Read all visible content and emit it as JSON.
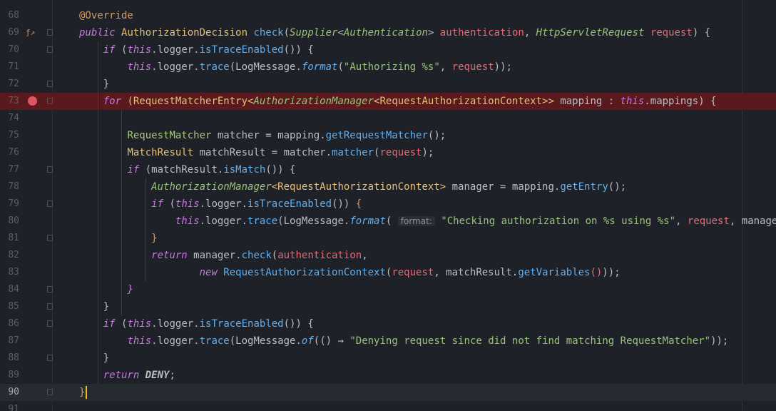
{
  "lines": [
    {
      "n": "68",
      "segs": [
        {
          "t": "@Override",
          "c": "ann"
        }
      ]
    },
    {
      "n": "69",
      "segs": [
        {
          "t": "public ",
          "c": "kw"
        },
        {
          "t": "AuthorizationDecision ",
          "c": "ty"
        },
        {
          "t": "check",
          "c": "fn"
        },
        {
          "t": "(",
          "c": "dim"
        },
        {
          "t": "Supplier",
          "c": "tyi"
        },
        {
          "t": "<",
          "c": "dim"
        },
        {
          "t": "Authentication",
          "c": "tyi"
        },
        {
          "t": "> ",
          "c": "dim"
        },
        {
          "t": "authentication",
          "c": "par"
        },
        {
          "t": ", ",
          "c": "dim"
        },
        {
          "t": "HttpServletRequest ",
          "c": "tyi"
        },
        {
          "t": "request",
          "c": "par"
        },
        {
          "t": ") {",
          "c": "dim"
        }
      ]
    },
    {
      "n": "70",
      "segs": [
        {
          "t": "    ",
          "c": "dim"
        },
        {
          "t": "if ",
          "c": "kw"
        },
        {
          "t": "(",
          "c": "dim"
        },
        {
          "t": "this",
          "c": "kw"
        },
        {
          "t": ".logger.",
          "c": "dim"
        },
        {
          "t": "isTraceEnabled",
          "c": "fn"
        },
        {
          "t": "()) {",
          "c": "dim"
        }
      ]
    },
    {
      "n": "71",
      "segs": [
        {
          "t": "        ",
          "c": "dim"
        },
        {
          "t": "this",
          "c": "kw"
        },
        {
          "t": ".logger.",
          "c": "dim"
        },
        {
          "t": "trace",
          "c": "fn"
        },
        {
          "t": "(LogMessage.",
          "c": "dim"
        },
        {
          "t": "format",
          "c": "fni"
        },
        {
          "t": "(",
          "c": "dim"
        },
        {
          "t": "\"Authorizing %s\"",
          "c": "str"
        },
        {
          "t": ", ",
          "c": "dim"
        },
        {
          "t": "request",
          "c": "par"
        },
        {
          "t": "));",
          "c": "dim"
        }
      ]
    },
    {
      "n": "72",
      "segs": [
        {
          "t": "    }",
          "c": "dim"
        }
      ]
    },
    {
      "n": "73",
      "bp": true,
      "segs": [
        {
          "t": "    ",
          "c": "dim"
        },
        {
          "t": "for ",
          "c": "kw"
        },
        {
          "t": "(RequestMatcherEntry<",
          "c": "ty"
        },
        {
          "t": "AuthorizationManager",
          "c": "tyi"
        },
        {
          "t": "<RequestAuthorizationContext>> ",
          "c": "ty"
        },
        {
          "t": "mapping : ",
          "c": "dim"
        },
        {
          "t": "this",
          "c": "kw"
        },
        {
          "t": ".mappings) {",
          "c": "dim"
        }
      ]
    },
    {
      "n": "74",
      "segs": []
    },
    {
      "n": "75",
      "segs": [
        {
          "t": "        ",
          "c": "dim"
        },
        {
          "t": "RequestMatcher ",
          "c": "tyg"
        },
        {
          "t": "matcher = mapping.",
          "c": "dim"
        },
        {
          "t": "getRequestMatcher",
          "c": "fn"
        },
        {
          "t": "();",
          "c": "dim"
        }
      ]
    },
    {
      "n": "76",
      "segs": [
        {
          "t": "        ",
          "c": "dim"
        },
        {
          "t": "MatchResult ",
          "c": "ty"
        },
        {
          "t": "matchResult = matcher.",
          "c": "dim"
        },
        {
          "t": "matcher",
          "c": "fn"
        },
        {
          "t": "(",
          "c": "dim"
        },
        {
          "t": "request",
          "c": "par"
        },
        {
          "t": ");",
          "c": "dim"
        }
      ]
    },
    {
      "n": "77",
      "segs": [
        {
          "t": "        ",
          "c": "dim"
        },
        {
          "t": "if ",
          "c": "kw"
        },
        {
          "t": "(matchResult.",
          "c": "dim"
        },
        {
          "t": "isMatch",
          "c": "fn"
        },
        {
          "t": "()) {",
          "c": "dim"
        }
      ]
    },
    {
      "n": "78",
      "segs": [
        {
          "t": "            ",
          "c": "dim"
        },
        {
          "t": "AuthorizationManager",
          "c": "tyi"
        },
        {
          "t": "<RequestAuthorizationContext> ",
          "c": "ty"
        },
        {
          "t": "manager = mapping.",
          "c": "dim"
        },
        {
          "t": "getEntry",
          "c": "fn"
        },
        {
          "t": "();",
          "c": "dim"
        }
      ]
    },
    {
      "n": "79",
      "segs": [
        {
          "t": "            ",
          "c": "dim"
        },
        {
          "t": "if ",
          "c": "kw"
        },
        {
          "t": "(",
          "c": "dim"
        },
        {
          "t": "this",
          "c": "kw"
        },
        {
          "t": ".logger.",
          "c": "dim"
        },
        {
          "t": "isTraceEnabled",
          "c": "fn"
        },
        {
          "t": "()) ",
          "c": "dim"
        },
        {
          "t": "{",
          "c": "ann"
        }
      ]
    },
    {
      "n": "80",
      "segs": [
        {
          "t": "                ",
          "c": "dim"
        },
        {
          "t": "this",
          "c": "kw"
        },
        {
          "t": ".logger.",
          "c": "dim"
        },
        {
          "t": "trace",
          "c": "fn"
        },
        {
          "t": "(LogMessage.",
          "c": "dim"
        },
        {
          "t": "format",
          "c": "fni"
        },
        {
          "t": "( ",
          "c": "dim"
        },
        {
          "t": "format:",
          "c": "hint"
        },
        {
          "t": " ",
          "c": "dim"
        },
        {
          "t": "\"Checking authorization on %s using %s\"",
          "c": "str"
        },
        {
          "t": ", ",
          "c": "dim"
        },
        {
          "t": "request",
          "c": "par"
        },
        {
          "t": ", manager));",
          "c": "dim"
        }
      ]
    },
    {
      "n": "81",
      "segs": [
        {
          "t": "            ",
          "c": "dim"
        },
        {
          "t": "}",
          "c": "ann"
        }
      ]
    },
    {
      "n": "82",
      "segs": [
        {
          "t": "            ",
          "c": "dim"
        },
        {
          "t": "return ",
          "c": "kw"
        },
        {
          "t": "manager.",
          "c": "dim"
        },
        {
          "t": "check",
          "c": "fn"
        },
        {
          "t": "(",
          "c": "dim"
        },
        {
          "t": "authentication",
          "c": "par"
        },
        {
          "t": ",",
          "c": "dim"
        }
      ]
    },
    {
      "n": "83",
      "segs": [
        {
          "t": "                    ",
          "c": "dim"
        },
        {
          "t": "new ",
          "c": "kw"
        },
        {
          "t": "RequestAuthorizationContext",
          "c": "fn"
        },
        {
          "t": "(",
          "c": "dim"
        },
        {
          "t": "request",
          "c": "par"
        },
        {
          "t": ", matchResult.",
          "c": "dim"
        },
        {
          "t": "getVariables",
          "c": "fn"
        },
        {
          "t": "()",
          "c": "par"
        },
        {
          "t": "));",
          "c": "dim"
        }
      ]
    },
    {
      "n": "84",
      "segs": [
        {
          "t": "        ",
          "c": "dim"
        },
        {
          "t": "}",
          "c": "kw"
        }
      ]
    },
    {
      "n": "85",
      "segs": [
        {
          "t": "    }",
          "c": "dim"
        }
      ]
    },
    {
      "n": "86",
      "segs": [
        {
          "t": "    ",
          "c": "dim"
        },
        {
          "t": "if ",
          "c": "kw"
        },
        {
          "t": "(",
          "c": "dim"
        },
        {
          "t": "this",
          "c": "kw"
        },
        {
          "t": ".logger.",
          "c": "dim"
        },
        {
          "t": "isTraceEnabled",
          "c": "fn"
        },
        {
          "t": "()) {",
          "c": "dim"
        }
      ]
    },
    {
      "n": "87",
      "segs": [
        {
          "t": "        ",
          "c": "dim"
        },
        {
          "t": "this",
          "c": "kw"
        },
        {
          "t": ".logger.",
          "c": "dim"
        },
        {
          "t": "trace",
          "c": "fn"
        },
        {
          "t": "(LogMessage.",
          "c": "dim"
        },
        {
          "t": "of",
          "c": "fni"
        },
        {
          "t": "(() → ",
          "c": "dim"
        },
        {
          "t": "\"Denying request since did not find matching RequestMatcher\"",
          "c": "str"
        },
        {
          "t": "));",
          "c": "dim"
        }
      ]
    },
    {
      "n": "88",
      "segs": [
        {
          "t": "    }",
          "c": "dim"
        }
      ]
    },
    {
      "n": "89",
      "segs": [
        {
          "t": "    ",
          "c": "dim"
        },
        {
          "t": "return ",
          "c": "kw"
        },
        {
          "t": "DENY",
          "c": "bold"
        },
        {
          "t": ";",
          "c": "dim"
        }
      ]
    },
    {
      "n": "90",
      "cur": true,
      "segs": [
        {
          "t": "}",
          "c": "ann"
        }
      ]
    },
    {
      "n": "91",
      "segs": []
    }
  ],
  "gutter_icons": {
    "69": "override-method-icon"
  },
  "breakpoint_line": "73",
  "fold_lines": [
    "69",
    "70",
    "72",
    "73",
    "77",
    "79",
    "81",
    "84",
    "85",
    "86",
    "88",
    "90"
  ]
}
